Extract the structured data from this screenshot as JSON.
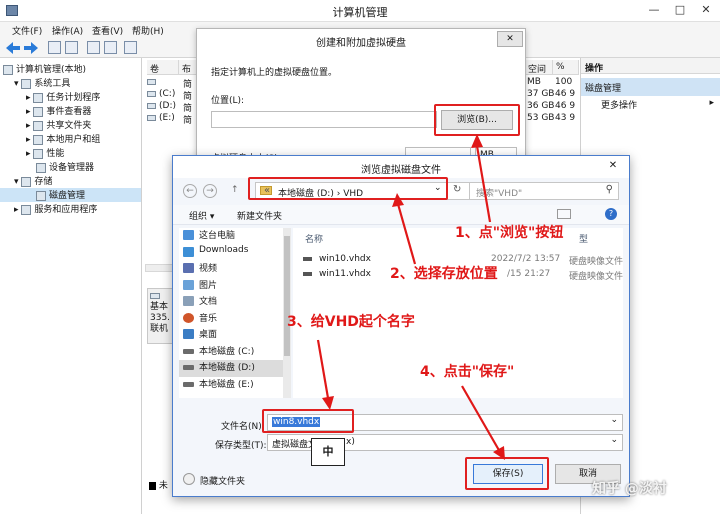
{
  "main_window": {
    "title": "计算机管理",
    "controls": [
      "—",
      "□",
      "✕"
    ],
    "menu": [
      "文件(F)",
      "操作(A)",
      "查看(V)",
      "帮助(H)"
    ],
    "tree": [
      {
        "label": "计算机管理(本地)",
        "level": 0,
        "expander": ""
      },
      {
        "label": "系统工具",
        "level": 1,
        "expander": "▾"
      },
      {
        "label": "任务计划程序",
        "level": 2,
        "expander": "▸"
      },
      {
        "label": "事件查看器",
        "level": 2,
        "expander": "▸"
      },
      {
        "label": "共享文件夹",
        "level": 2,
        "expander": "▸"
      },
      {
        "label": "本地用户和组",
        "level": 2,
        "expander": "▸"
      },
      {
        "label": "性能",
        "level": 2,
        "expander": "▸"
      },
      {
        "label": "设备管理器",
        "level": 2,
        "expander": ""
      },
      {
        "label": "存储",
        "level": 1,
        "expander": "▾"
      },
      {
        "label": "磁盘管理",
        "level": 2,
        "expander": "",
        "selected": true
      },
      {
        "label": "服务和应用程序",
        "level": 1,
        "expander": "▸"
      }
    ],
    "volume_header": [
      "卷",
      "布"
    ],
    "volumes": [
      {
        "name": "",
        "type": "简"
      },
      {
        "name": "(C:)",
        "type": "简"
      },
      {
        "name": "(D:)",
        "type": "简"
      },
      {
        "name": "(E:)",
        "type": "简"
      }
    ],
    "space_header": [
      "空间",
      "%"
    ],
    "space_rows": [
      {
        "free": "MB",
        "pct": "100"
      },
      {
        "free": "37 GB",
        "pct": "46 9"
      },
      {
        "free": "36 GB",
        "pct": "46 9"
      },
      {
        "free": "53 GB",
        "pct": "43 9"
      }
    ],
    "disk_info": [
      "基本",
      "335.",
      "联机"
    ],
    "legend_text": "未",
    "actions": {
      "header": "操作",
      "selected": "磁盘管理",
      "more": "更多操作",
      "more_arrow": "▸"
    }
  },
  "vhd_dialog": {
    "title": "创建和附加虚拟硬盘",
    "instruction": "指定计算机上的虚拟硬盘位置。",
    "location_label": "位置(L):",
    "location_value": "",
    "browse_button": "浏览(B)...",
    "size_label": "虚拟硬盘大小(S):",
    "size_unit": "MB",
    "close": "✕"
  },
  "file_dialog": {
    "title": "浏览虚拟磁盘文件",
    "close": "✕",
    "back": "←",
    "forward": "→",
    "up": "↑",
    "address_prefix": "«",
    "address_crumbs": [
      "本地磁盘 (D:)",
      "›",
      "VHD"
    ],
    "address_dropdown": "⌄",
    "refresh": "↻",
    "search_placeholder": "搜索\"VHD\"",
    "toolbar": {
      "organize": "组织 ▾",
      "new_folder": "新建文件夹",
      "help": "?"
    },
    "nav_items": [
      {
        "label": "这台电脑",
        "icon": "computer-icon",
        "color": "#4a90d9"
      },
      {
        "label": "Downloads",
        "icon": "download-icon",
        "color": "#3d8fd6"
      },
      {
        "label": "视频",
        "icon": "video-icon",
        "color": "#5a6fb0"
      },
      {
        "label": "图片",
        "icon": "picture-icon",
        "color": "#6aa2d8"
      },
      {
        "label": "文档",
        "icon": "document-icon",
        "color": "#8aa0b8"
      },
      {
        "label": "音乐",
        "icon": "music-icon",
        "color": "#d0552a"
      },
      {
        "label": "桌面",
        "icon": "desktop-icon",
        "color": "#3b7dc4"
      },
      {
        "label": "本地磁盘 (C:)",
        "icon": "drive-icon",
        "color": "#6b6b6b"
      },
      {
        "label": "本地磁盘 (D:)",
        "icon": "drive-icon",
        "color": "#6b6b6b",
        "selected": true
      },
      {
        "label": "本地磁盘 (E:)",
        "icon": "drive-icon",
        "color": "#6b6b6b"
      }
    ],
    "columns": [
      "名称",
      "型"
    ],
    "files": [
      {
        "name": "win10.vhdx",
        "date": "2022/7/2 13:57",
        "type": "硬盘映像文件"
      },
      {
        "name": "win11.vhdx",
        "date": "/15 21:27",
        "type": "硬盘映像文件"
      }
    ],
    "filename_label": "文件名(N):",
    "filename_value": "win8.vhdx",
    "filetype_label": "保存类型(T):",
    "filetype_value": "虚拟磁盘文",
    "filetype_tail": "x)",
    "ime_indicator": "中",
    "hide_folders": "隐藏文件夹",
    "save_button": "保存(S)",
    "cancel_button": "取消"
  },
  "annotations": [
    {
      "text": "1、点\"浏览\"按钮"
    },
    {
      "text": "2、选择存放位置"
    },
    {
      "text": "3、给VHD起个名字"
    },
    {
      "text": "4、点击\"保存\""
    }
  ],
  "watermark": "知乎 @淡衬",
  "colors": {
    "annotation_red": "#e01818",
    "selection_blue": "#3879d9",
    "accent_blue": "#4a7ccc"
  }
}
